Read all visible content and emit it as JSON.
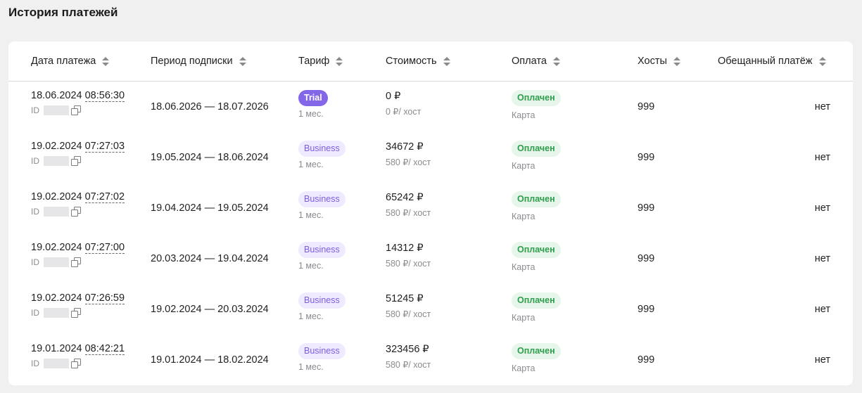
{
  "page": {
    "title": "История платежей"
  },
  "table": {
    "columns": [
      {
        "label": "Дата платежа",
        "sort_icon": "sort-arrows-icon"
      },
      {
        "label": "Период подписки",
        "sort_icon": "sort-arrows-icon"
      },
      {
        "label": "Тариф",
        "sort_icon": "sort-arrows-icon"
      },
      {
        "label": "Стоимость",
        "sort_icon": "sort-arrows-icon"
      },
      {
        "label": "Оплата",
        "sort_icon": "sort-arrows-icon"
      },
      {
        "label": "Хосты",
        "sort_icon": "sort-arrows-icon"
      },
      {
        "label": "Обещанный платёж",
        "sort_icon": "sort-arrows-icon"
      }
    ],
    "rows": [
      {
        "date": "18.06.2024",
        "time": "08:56:30",
        "id_label": "ID",
        "period": "18.06.2026 — 18.07.2026",
        "tariff": "Trial",
        "tariff_kind": "trial",
        "duration": "1 мес.",
        "cost": "0 ₽",
        "cost_per_host": "0 ₽/ хост",
        "payment_status": "Оплачен",
        "payment_method": "Карта",
        "hosts": "999",
        "promised": "нет"
      },
      {
        "date": "19.02.2024",
        "time": "07:27:03",
        "id_label": "ID",
        "period": "19.05.2024 — 18.06.2024",
        "tariff": "Business",
        "tariff_kind": "business",
        "duration": "1 мес.",
        "cost": "34672 ₽",
        "cost_per_host": "580 ₽/ хост",
        "payment_status": "Оплачен",
        "payment_method": "Карта",
        "hosts": "999",
        "promised": "нет"
      },
      {
        "date": "19.02.2024",
        "time": "07:27:02",
        "id_label": "ID",
        "period": "19.04.2024 — 19.05.2024",
        "tariff": "Business",
        "tariff_kind": "business",
        "duration": "1 мес.",
        "cost": "65242 ₽",
        "cost_per_host": "580 ₽/ хост",
        "payment_status": "Оплачен",
        "payment_method": "Карта",
        "hosts": "999",
        "promised": "нет"
      },
      {
        "date": "19.02.2024",
        "time": "07:27:00",
        "id_label": "ID",
        "period": "20.03.2024 — 19.04.2024",
        "tariff": "Business",
        "tariff_kind": "business",
        "duration": "1 мес.",
        "cost": "14312 ₽",
        "cost_per_host": "580 ₽/ хост",
        "payment_status": "Оплачен",
        "payment_method": "Карта",
        "hosts": "999",
        "promised": "нет"
      },
      {
        "date": "19.02.2024",
        "time": "07:26:59",
        "id_label": "ID",
        "period": "19.02.2024 — 20.03.2024",
        "tariff": "Business",
        "tariff_kind": "business",
        "duration": "1 мес.",
        "cost": "51245 ₽",
        "cost_per_host": "580 ₽/ хост",
        "payment_status": "Оплачен",
        "payment_method": "Карта",
        "hosts": "999",
        "promised": "нет"
      },
      {
        "date": "19.01.2024",
        "time": "08:42:21",
        "id_label": "ID",
        "period": "19.01.2024 — 18.02.2024",
        "tariff": "Business",
        "tariff_kind": "business",
        "duration": "1 мес.",
        "cost": "323456 ₽",
        "cost_per_host": "580 ₽/ хост",
        "payment_status": "Оплачен",
        "payment_method": "Карта",
        "hosts": "999",
        "promised": "нет"
      }
    ]
  },
  "colors": {
    "page_background": "#f0f0f1",
    "trial_badge": "#8467e8",
    "business_badge_bg": "#efeaff",
    "business_badge_text": "#7b5de3",
    "paid_badge_bg": "#e6f6ea",
    "paid_badge_text": "#2f9d4d"
  }
}
